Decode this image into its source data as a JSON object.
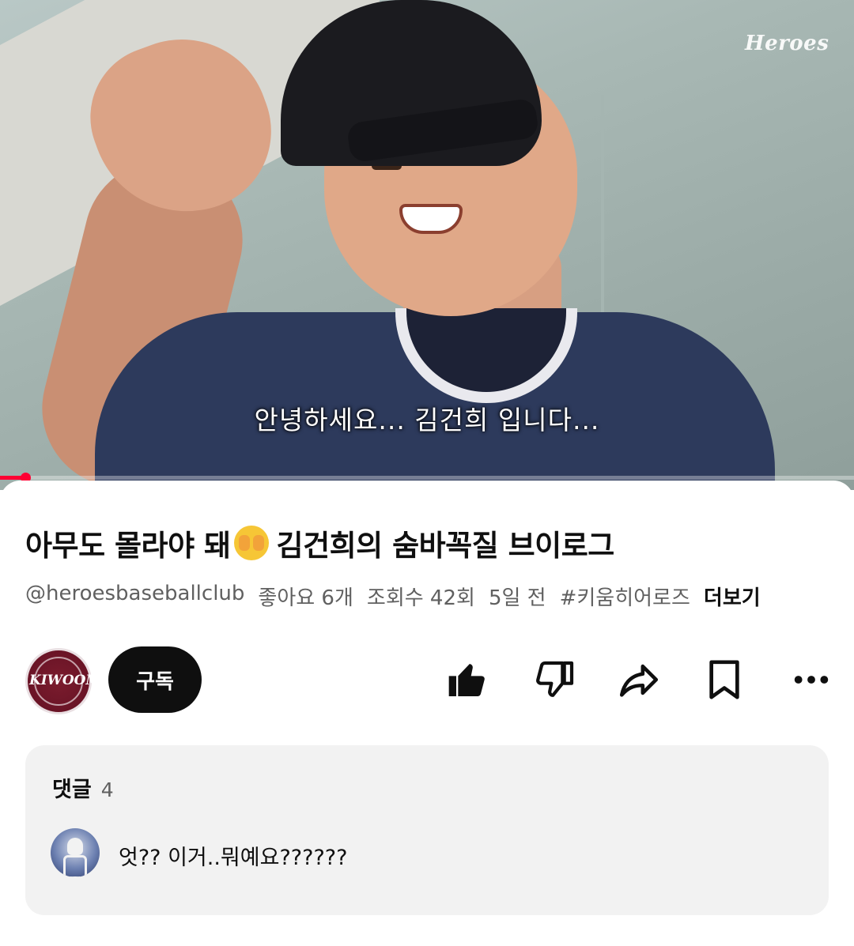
{
  "video": {
    "brand_watermark": "Heroes",
    "subtitle": "안녕하세요... 김건희 입니다...",
    "progress_fraction": 0.03
  },
  "title": {
    "text_before_emoji": "아무도 몰라야 돼",
    "emoji_icon": "face-with-peeking-eye",
    "text_after_emoji": "김건희의 숨바꼭질 브이로그"
  },
  "meta": {
    "channel_handle": "@heroesbaseballclub",
    "likes": "좋아요 6개",
    "views": "조회수 42회",
    "age": "5일 전",
    "hashtag": "#키움히어로즈",
    "more_label": "더보기"
  },
  "channel": {
    "avatar_logo_text": "KIWOOM",
    "subscribe_label": "구독"
  },
  "actions": {
    "icons": [
      "thumbs-up-icon",
      "thumbs-down-icon",
      "share-icon",
      "save-icon",
      "more-icon"
    ]
  },
  "comments": {
    "title": "댓글",
    "count": "4",
    "top_comment": "엇?? 이거..뭐예요??????"
  },
  "colors": {
    "progress": "#ff0033",
    "subscribe_bg": "#0f0f0f",
    "comments_bg": "#f2f2f2",
    "avatar_brand": "#6a1426"
  }
}
